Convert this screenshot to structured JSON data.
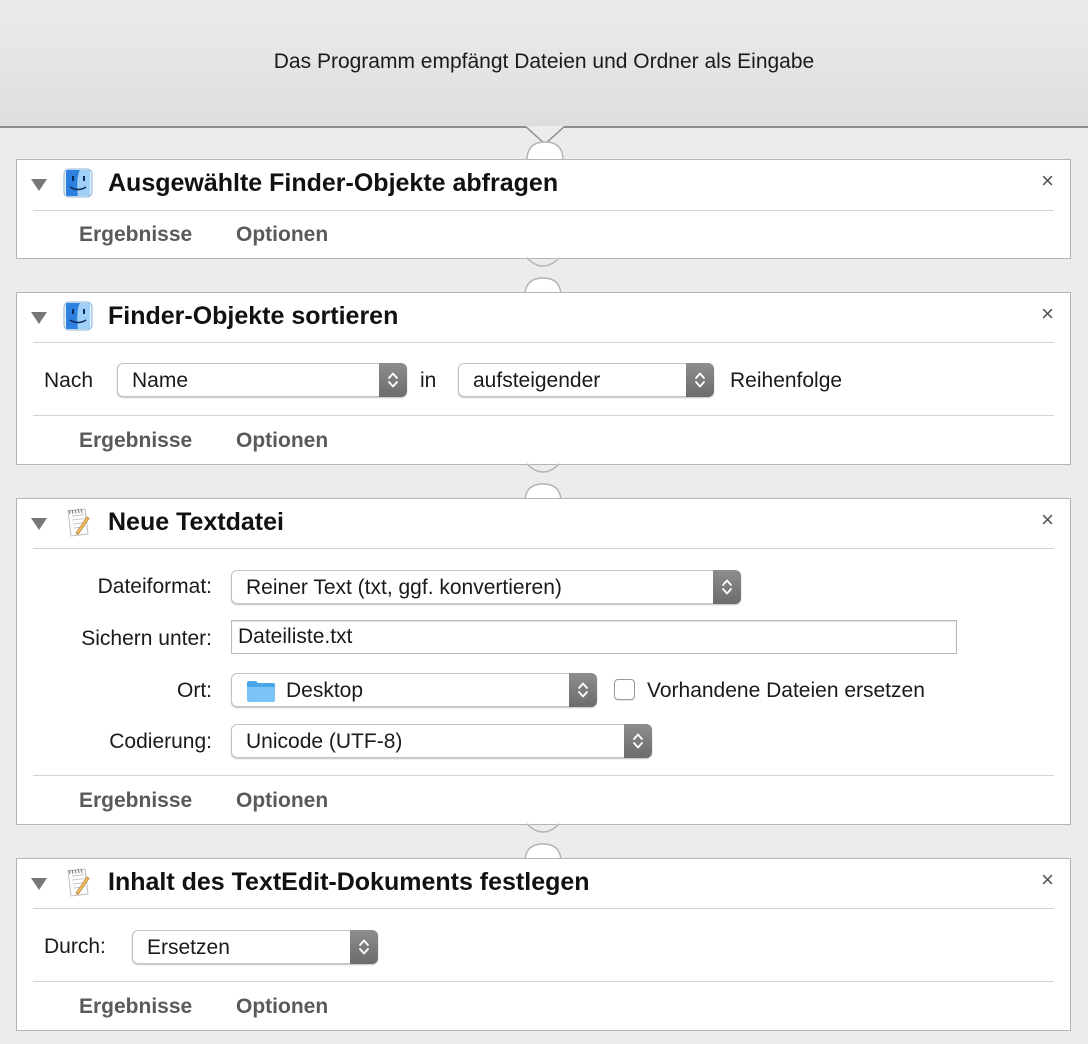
{
  "workflow": {
    "header_text": "Das Programm empfängt Dateien und Ordner als Eingabe"
  },
  "footer": {
    "results_label": "Ergebnisse",
    "options_label": "Optionen"
  },
  "close_glyph": "×",
  "actions": [
    {
      "icon": "finder-icon",
      "title": "Ausgewählte Finder-Objekte abfragen"
    },
    {
      "icon": "finder-icon",
      "title": "Finder-Objekte sortieren",
      "by_label": "Nach",
      "by_value": "Name",
      "in_label": "in",
      "order_value": "aufsteigender",
      "order_suffix": "Reihenfolge"
    },
    {
      "icon": "textedit-icon",
      "title": "Neue Textdatei",
      "format_label": "Dateiformat:",
      "format_value": "Reiner Text (txt, ggf. konvertieren)",
      "save_as_label": "Sichern unter:",
      "save_as_value": "Dateiliste.txt",
      "location_label": "Ort:",
      "location_value": "Desktop",
      "replace_label": "Vorhandene Dateien ersetzen",
      "replace_checked": false,
      "encoding_label": "Codierung:",
      "encoding_value": "Unicode (UTF-8)"
    },
    {
      "icon": "textedit-icon",
      "title": "Inhalt des TextEdit-Dokuments festlegen",
      "mode_label": "Durch:",
      "mode_value": "Ersetzen"
    }
  ],
  "colors": {
    "accent_folder": "#5ab4f0",
    "finder_blue": "#2d7fe0",
    "stepper_gray": "#7a7a7a"
  }
}
